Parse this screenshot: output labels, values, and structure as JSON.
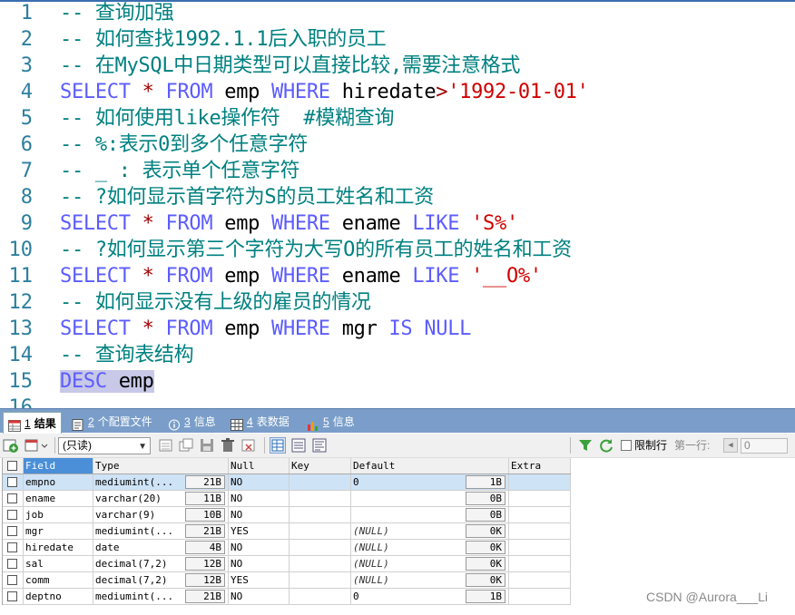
{
  "editor": {
    "lines": [
      {
        "n": "1",
        "tokens": [
          {
            "t": "-- 查询加强",
            "c": "cm"
          }
        ]
      },
      {
        "n": "2",
        "tokens": [
          {
            "t": "-- 如何查找1992.1.1后入职的员工",
            "c": "cm"
          }
        ]
      },
      {
        "n": "3",
        "tokens": [
          {
            "t": "-- 在MySQL中日期类型可以直接比较,需要注意格式",
            "c": "cm"
          }
        ]
      },
      {
        "n": "4",
        "tokens": [
          {
            "t": "SELECT ",
            "c": "kw"
          },
          {
            "t": "* ",
            "c": "as"
          },
          {
            "t": "FROM ",
            "c": "kw"
          },
          {
            "t": "emp ",
            "c": "id"
          },
          {
            "t": "WHERE ",
            "c": "kw"
          },
          {
            "t": "hiredate",
            "c": "id"
          },
          {
            "t": ">",
            "c": "op"
          },
          {
            "t": "'1992-01-01'",
            "c": "st"
          }
        ]
      },
      {
        "n": "5",
        "tokens": [
          {
            "t": "-- 如何使用like操作符  #模糊查询",
            "c": "cm"
          }
        ]
      },
      {
        "n": "6",
        "tokens": [
          {
            "t": "-- %:表示0到多个任意字符",
            "c": "cm"
          }
        ]
      },
      {
        "n": "7",
        "tokens": [
          {
            "t": "-- _ : 表示单个任意字符",
            "c": "cm"
          }
        ]
      },
      {
        "n": "8",
        "tokens": [
          {
            "t": "-- ?如何显示首字符为S的员工姓名和工资",
            "c": "cm"
          }
        ]
      },
      {
        "n": "9",
        "tokens": [
          {
            "t": "SELECT ",
            "c": "kw"
          },
          {
            "t": "* ",
            "c": "as"
          },
          {
            "t": "FROM ",
            "c": "kw"
          },
          {
            "t": "emp ",
            "c": "id"
          },
          {
            "t": "WHERE ",
            "c": "kw"
          },
          {
            "t": "ename ",
            "c": "id"
          },
          {
            "t": "LIKE ",
            "c": "kw"
          },
          {
            "t": "'S%'",
            "c": "st"
          }
        ]
      },
      {
        "n": "10",
        "tokens": [
          {
            "t": "-- ?如何显示第三个字符为大写O的所有员工的姓名和工资",
            "c": "cm"
          }
        ]
      },
      {
        "n": "11",
        "tokens": [
          {
            "t": "SELECT ",
            "c": "kw"
          },
          {
            "t": "* ",
            "c": "as"
          },
          {
            "t": "FROM ",
            "c": "kw"
          },
          {
            "t": "emp ",
            "c": "id"
          },
          {
            "t": "WHERE ",
            "c": "kw"
          },
          {
            "t": "ename ",
            "c": "id"
          },
          {
            "t": "LIKE ",
            "c": "kw"
          },
          {
            "t": "'__O%'",
            "c": "st"
          }
        ]
      },
      {
        "n": "12",
        "tokens": [
          {
            "t": "-- 如何显示没有上级的雇员的情况",
            "c": "cm"
          }
        ]
      },
      {
        "n": "13",
        "tokens": [
          {
            "t": "SELECT ",
            "c": "kw"
          },
          {
            "t": "* ",
            "c": "as"
          },
          {
            "t": "FROM ",
            "c": "kw"
          },
          {
            "t": "emp ",
            "c": "id"
          },
          {
            "t": "WHERE ",
            "c": "kw"
          },
          {
            "t": "mgr ",
            "c": "id"
          },
          {
            "t": "IS ",
            "c": "kw"
          },
          {
            "t": "NULL",
            "c": "kw"
          }
        ]
      },
      {
        "n": "14",
        "tokens": [
          {
            "t": "-- 查询表结构",
            "c": "cm"
          }
        ]
      },
      {
        "n": "15",
        "tokens": [
          {
            "t": "DESC ",
            "c": "kw",
            "sel": true
          },
          {
            "t": "emp",
            "c": "id",
            "sel": true
          }
        ]
      },
      {
        "n": "16",
        "tokens": []
      }
    ]
  },
  "tabs": [
    {
      "num": "1",
      "label": "结果",
      "icon": "result-table-icon",
      "active": true
    },
    {
      "num": "2",
      "label": "个配置文件",
      "icon": "profile-icon",
      "active": false
    },
    {
      "num": "3",
      "label": "信息",
      "icon": "info-icon",
      "active": false
    },
    {
      "num": "4",
      "label": "表数据",
      "icon": "table-data-icon",
      "active": false
    },
    {
      "num": "5",
      "label": "信息",
      "icon": "info-chart-icon",
      "active": false
    }
  ],
  "toolbar": {
    "readonly_select": "(只读)",
    "limit_label": "限制行",
    "first_row_label": "第一行:",
    "first_row_value": "0",
    "prev_glyph": "◀"
  },
  "grid": {
    "headers": [
      "Field",
      "Type",
      "Null",
      "Key",
      "Default",
      "Extra"
    ],
    "rows": [
      {
        "field": "empno",
        "type": "mediumint(...",
        "size": "21B",
        "null": "NO",
        "key": "",
        "default": "0",
        "default_null": false,
        "dsize": "1B",
        "extra": ""
      },
      {
        "field": "ename",
        "type": "varchar(20)",
        "size": "11B",
        "null": "NO",
        "key": "",
        "default": "",
        "default_null": false,
        "dsize": "0B",
        "extra": ""
      },
      {
        "field": "job",
        "type": "varchar(9)",
        "size": "10B",
        "null": "NO",
        "key": "",
        "default": "",
        "default_null": false,
        "dsize": "0B",
        "extra": ""
      },
      {
        "field": "mgr",
        "type": "mediumint(...",
        "size": "21B",
        "null": "YES",
        "key": "",
        "default": "(NULL)",
        "default_null": true,
        "dsize": "0K",
        "extra": ""
      },
      {
        "field": "hiredate",
        "type": "date",
        "size": "4B",
        "null": "NO",
        "key": "",
        "default": "(NULL)",
        "default_null": true,
        "dsize": "0K",
        "extra": ""
      },
      {
        "field": "sal",
        "type": "decimal(7,2)",
        "size": "12B",
        "null": "NO",
        "key": "",
        "default": "(NULL)",
        "default_null": true,
        "dsize": "0K",
        "extra": ""
      },
      {
        "field": "comm",
        "type": "decimal(7,2)",
        "size": "12B",
        "null": "YES",
        "key": "",
        "default": "(NULL)",
        "default_null": true,
        "dsize": "0K",
        "extra": ""
      },
      {
        "field": "deptno",
        "type": "mediumint(...",
        "size": "21B",
        "null": "NO",
        "key": "",
        "default": "0",
        "default_null": false,
        "dsize": "1B",
        "extra": ""
      }
    ]
  },
  "watermark": "CSDN @Aurora___Li"
}
